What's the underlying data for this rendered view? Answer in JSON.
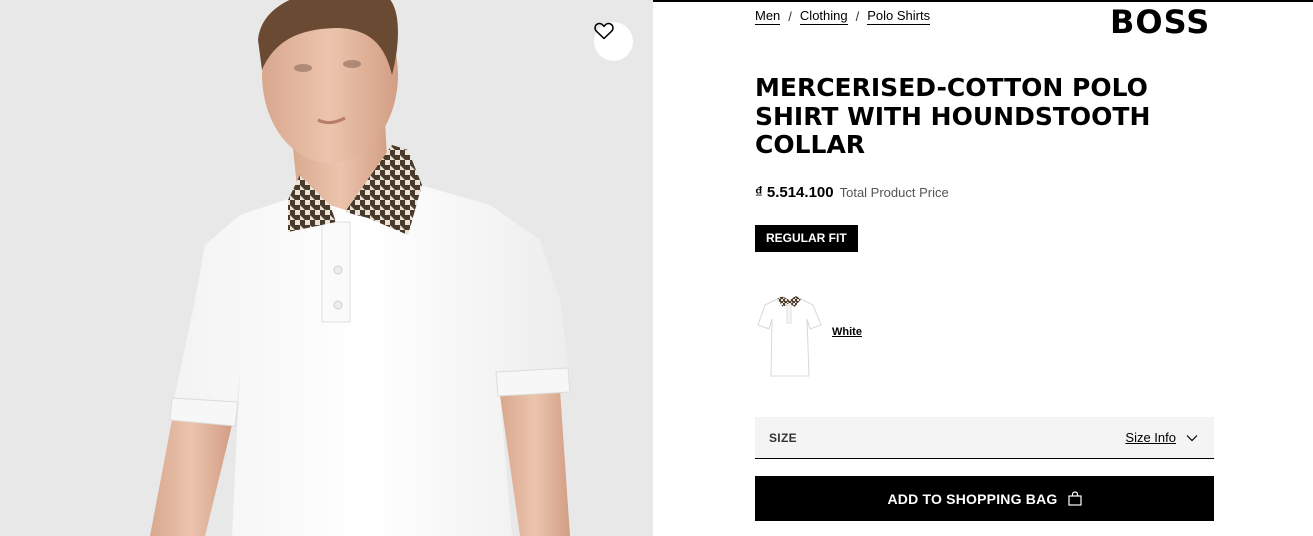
{
  "breadcrumb": [
    {
      "label": "Men"
    },
    {
      "label": "Clothing"
    },
    {
      "label": "Polo Shirts"
    }
  ],
  "breadcrumb_separator": "/",
  "brand": "BOSS",
  "product": {
    "title": "MERCERISED-COTTON POLO SHIRT WITH HOUNDSTOOTH COLLAR",
    "price": "₫ 5.514.100",
    "price_label": "Total Product Price",
    "fit": "REGULAR FIT",
    "color": "White"
  },
  "size": {
    "label": "SIZE",
    "info_link": "Size Info"
  },
  "cta": {
    "add_to_bag": "ADD TO SHOPPING BAG"
  },
  "icons": {
    "wishlist": "heart-icon",
    "size_toggle": "chevron-down-icon",
    "bag": "shopping-bag-icon"
  },
  "colors": {
    "accent": "#000000",
    "image_background": "#e7e7e7",
    "size_background": "#f4f4f4"
  }
}
